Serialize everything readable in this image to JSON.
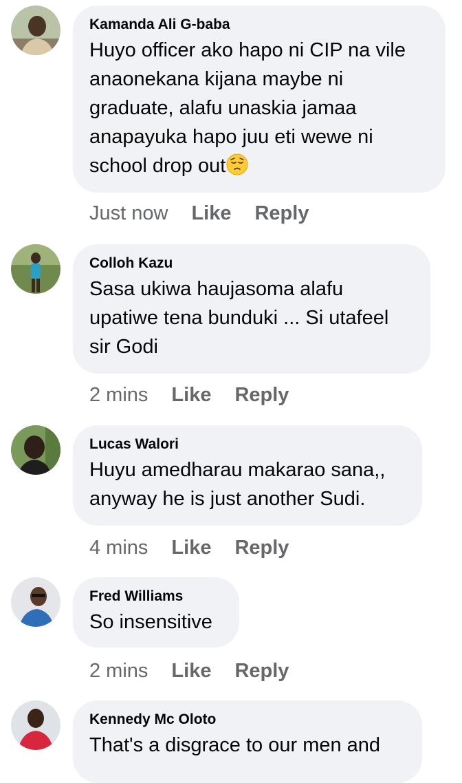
{
  "comments": [
    {
      "author": "Kamanda Ali G-baba",
      "text_lines": [
        "Huyo officer ako hapo ni CIP na vile",
        "anaonekana kijana maybe ni",
        "graduate, alafu unaskia jamaa",
        "anapayuka hapo juu eti wewe ni",
        "school drop out"
      ],
      "emoji": "pensive-face-emoji",
      "time": "Just now",
      "like_label": "Like",
      "reply_label": "Reply"
    },
    {
      "author": "Colloh Kazu",
      "text_lines": [
        "Sasa ukiwa haujasoma alafu",
        "upatiwe tena bunduki ... Si utafeel",
        "sir Godi"
      ],
      "time": "2 mins",
      "like_label": "Like",
      "reply_label": "Reply"
    },
    {
      "author": "Lucas Walori",
      "text_lines": [
        "Huyu amedharau makarao sana,,",
        "anyway he is just another Sudi."
      ],
      "time": "4 mins",
      "like_label": "Like",
      "reply_label": "Reply"
    },
    {
      "author": "Fred Williams",
      "text_lines": [
        "So insensitive"
      ],
      "time": "2 mins",
      "like_label": "Like",
      "reply_label": "Reply"
    },
    {
      "author": "Kennedy Mc Oloto",
      "text_lines": [
        "That's a disgrace to our men and"
      ]
    }
  ],
  "colors": {
    "bubble_bg": "#f0f2f5",
    "meta_text": "#65676b",
    "body_text": "#050505"
  }
}
